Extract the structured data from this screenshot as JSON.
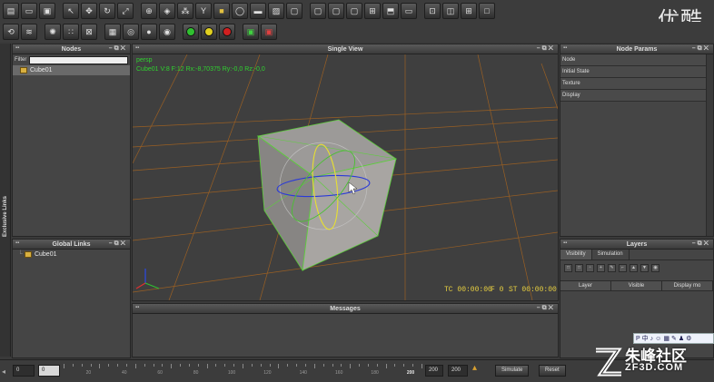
{
  "toolbar1": {
    "icons": [
      "new-scene-icon",
      "open-icon",
      "save-icon",
      "select-icon",
      "move-icon",
      "rotate-icon",
      "scale-icon",
      "add-node-icon",
      "cube-icon",
      "molecule-icon",
      "branch-icon",
      "gold-cube-icon",
      "torus-icon",
      "camera-icon",
      "image-icon",
      "frame-icon",
      "frame-add-icon",
      "frame-alt-icon",
      "frame-shift-icon",
      "pan-icon",
      "cube3d-icon",
      "window-icon",
      "fit-icon",
      "dual-view-icon",
      "quad-view-icon",
      "single-view-icon"
    ]
  },
  "toolbar2": {
    "icons": [
      "link-icon",
      "fluid-icon",
      "emitter-icon",
      "particles-icon",
      "collider-icon",
      "grid-node-icon",
      "swirl-icon",
      "sphere-icon",
      "sim-icon",
      "play-green-icon",
      "pause-yellow-icon",
      "stop-red-icon",
      "save-green-icon",
      "save-red-icon"
    ]
  },
  "watermark_top": "优酷",
  "side_strip": {
    "label": "Exclusive Links"
  },
  "nodes_panel": {
    "title": "Nodes",
    "filter_label": "Filter",
    "items": [
      {
        "label": "Cube01"
      }
    ]
  },
  "global_links_panel": {
    "title": "Global Links",
    "items": [
      {
        "label": "Cube01"
      }
    ]
  },
  "viewport": {
    "title": "Single View",
    "camera": "persp",
    "object_info": "Cube01 V:8 F:12 Rx:-8,70375 Ry:-0,0 Rz:-0,0",
    "tc": "TC 00:00:00",
    "frame": "F 0",
    "st": "ST 00:00:00"
  },
  "messages_panel": {
    "title": "Messages"
  },
  "node_params_panel": {
    "title": "Node Params",
    "rows": [
      "Node",
      "Initial State",
      "Texture",
      "Display"
    ]
  },
  "layers_panel": {
    "title": "Layers",
    "tabs": [
      "Visibility",
      "Simulation"
    ],
    "columns": [
      "Layer",
      "Visible",
      "Display mo"
    ]
  },
  "timeline": {
    "start": "0",
    "current": "0",
    "ticks": [
      "20",
      "40",
      "60",
      "80",
      "100",
      "120",
      "140",
      "160",
      "180",
      "200"
    ],
    "end_label": "200",
    "end1": "200",
    "end2": "200",
    "simulate": "Simulate",
    "reset": "Reset"
  },
  "watermark_bottom": {
    "bar_chars": [
      "P",
      "中",
      "♪",
      "☺",
      "▦",
      "✎",
      "♟",
      "⚙"
    ],
    "brand_cn": "朱峰社区",
    "brand_en": "ZF3D.COM"
  },
  "colors": {
    "accent_green": "#2fd22f",
    "hud_yellow": "#e8d040",
    "grid_orange": "#c87020"
  }
}
